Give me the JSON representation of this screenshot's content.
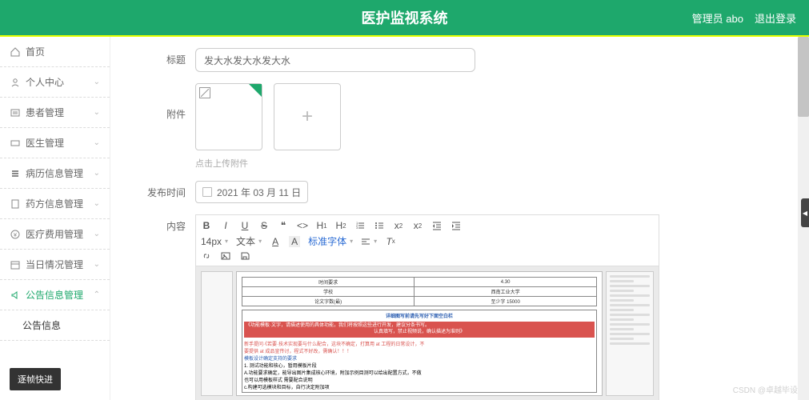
{
  "header": {
    "title": "医护监视系统",
    "admin_label": "管理员 abo",
    "logout_label": "退出登录"
  },
  "sidebar": {
    "items": [
      {
        "label": "首页",
        "icon": "home"
      },
      {
        "label": "个人中心",
        "icon": "user"
      },
      {
        "label": "患者管理",
        "icon": "list"
      },
      {
        "label": "医生管理",
        "icon": "card"
      },
      {
        "label": "病历信息管理",
        "icon": "stack"
      },
      {
        "label": "药方信息管理",
        "icon": "rx"
      },
      {
        "label": "医疗费用管理",
        "icon": "money"
      },
      {
        "label": "当日情况管理",
        "icon": "cal"
      },
      {
        "label": "公告信息管理",
        "icon": "speaker"
      }
    ],
    "sub_label": "公告信息"
  },
  "form": {
    "title_label": "标题",
    "title_value": "发大水发大水发大水",
    "attach_label": "附件",
    "upload_hint": "点击上传附件",
    "pubtime_label": "发布时间",
    "pubtime_value": "2021 年 03 月 11 日",
    "content_label": "内容"
  },
  "editor": {
    "fontsize": "14px",
    "format": "文本",
    "fontfamily": "标准字体"
  },
  "doc": {
    "r1c1": "时间要求",
    "r1c2": "4.30",
    "r2c1": "学校",
    "r2c2": "西南工业大学",
    "r3c1": "论文字数(最)",
    "r3c2": "至少字 15000",
    "band_title": "详细图写前请先写好下面空白栏",
    "band_line1": "《功能模板·文字，请描述使用的具体功能，我们将按照这些进行开发，建议分条书写。",
    "band_line2": "认真填写，禁止视频说，确认描述为准则》",
    "redline": "新手提问·《若要·技术实现要与什么配合，这块不确定，打算用 at 工程的日常设计，不",
    "red2": "要提供 at 成品宣传讨，程式不好改，需确认！！！",
    "b1": "模板设计确定支持的要求",
    "b2": "1.  测试功能和核心，暂用模板片段",
    "b3": "A.功能要求确定，能导出图片集成核心环境，附加示例目测可以给出配置方式，不做",
    "b4": "也可以用模板样式 需要配合说明",
    "b5": "c.构建可选模块和目标，自行决定附加项"
  },
  "float_btn": "逐帧快进",
  "watermark": "CSDN @卓越毕设"
}
